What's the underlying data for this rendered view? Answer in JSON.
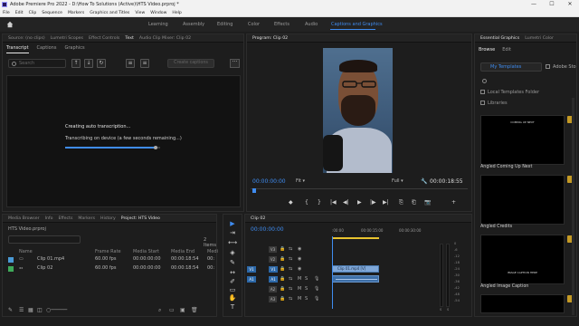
{
  "window": {
    "title": "Adobe Premiere Pro 2022 - D:\\How To Solutions (Active)\\HTS Video.prproj *",
    "controls": [
      "—",
      "☐",
      "✕"
    ]
  },
  "menu": [
    "File",
    "Edit",
    "Clip",
    "Sequence",
    "Markers",
    "Graphics and Titles",
    "View",
    "Window",
    "Help"
  ],
  "workspaces": {
    "tabs": [
      "Learning",
      "Assembly",
      "Editing",
      "Color",
      "Effects",
      "Audio",
      "Captions and Graphics"
    ],
    "active": "Captions and Graphics"
  },
  "text_panel": {
    "tabs": [
      "Source: (no clips)",
      "Lumetri Scopes",
      "Effect Controls",
      "Text",
      "Audio Clip Mixer: Clip 02"
    ],
    "subtabs": [
      "Transcript",
      "Captions",
      "Graphics"
    ],
    "search_placeholder": "Search",
    "buttons": {
      "up": "↑",
      "down": "↓",
      "refresh": "↻",
      "create_captions": "Create captions",
      "more": "···"
    },
    "status_title": "Creating auto transcription...",
    "status_detail": "Transcribing on device (a few seconds remaining...)",
    "progress": 0.95
  },
  "program": {
    "tab": "Program: Clip 02",
    "timecode": "00:00:00:00",
    "fit": "Fit",
    "quality": "Full",
    "duration": "00:00:18:55",
    "transport": [
      "◆",
      "{",
      "}",
      "|◀",
      "◀|",
      "▶",
      "|▶",
      "▶|",
      "⎘",
      "⎗",
      "📷",
      "+"
    ]
  },
  "essential_graphics": {
    "tabs": [
      "Essential Graphics",
      "Lumetri Color"
    ],
    "subtabs": [
      "Browse",
      "Edit"
    ],
    "source": "My Templates",
    "adobe_stock": "Adobe Sto",
    "local_templates_folder": "Local Templates Folder",
    "libraries": "Libraries",
    "templates": [
      {
        "name": "Angled Coming Up Next",
        "preview": "COMING UP NEXT"
      },
      {
        "name": "Angled Credits",
        "preview": ""
      },
      {
        "name": "Angled Image Caption",
        "preview": "IMAGE CAPTION HERE"
      }
    ]
  },
  "project": {
    "tabs": [
      "Media Browser",
      "Info",
      "Effects",
      "Markers",
      "History",
      "Project: HTS Video"
    ],
    "name": "HTS Video.prproj",
    "item_count": "2 Items",
    "columns": [
      "Name",
      "Frame Rate",
      "Media Start",
      "Media End",
      "Medi"
    ],
    "rows": [
      {
        "name": "Clip 01.mp4",
        "fps": "60.00 fps",
        "start": "00:00:00:00",
        "end": "00:00:18:54",
        "media": "00:",
        "color": "#4a9ad6"
      },
      {
        "name": "Clip 02",
        "fps": "60.00 fps",
        "start": "00:00:00:00",
        "end": "00:00:18:54",
        "media": "00:",
        "color": "#3faa5a"
      }
    ]
  },
  "tools": [
    "▶",
    "⇥",
    "⟷",
    "◈",
    "✎",
    "↔",
    "✐",
    "▭",
    "✋",
    "T"
  ],
  "timeline": {
    "tab": "Clip 02",
    "timecode": "00:00:00:00",
    "ruler": [
      ":00:00",
      "00:00:15:00",
      "00:00:30:00"
    ],
    "video_tracks": [
      {
        "src": "",
        "name": "V3"
      },
      {
        "src": "",
        "name": "V2"
      },
      {
        "src": "V1",
        "name": "V1"
      }
    ],
    "audio_tracks": [
      {
        "src": "A1",
        "name": "A1"
      },
      {
        "src": "",
        "name": "A2"
      },
      {
        "src": "",
        "name": "A3"
      }
    ],
    "track_letters": {
      "mute": "M",
      "solo": "S"
    },
    "video_clip": "Clip 01.mp4 [V]",
    "meter_scale": [
      "0",
      "-6",
      "-12",
      "-18",
      "-24",
      "-30",
      "-36",
      "-42",
      "-48",
      "-54"
    ],
    "meter_labels": [
      "S",
      "S"
    ]
  }
}
